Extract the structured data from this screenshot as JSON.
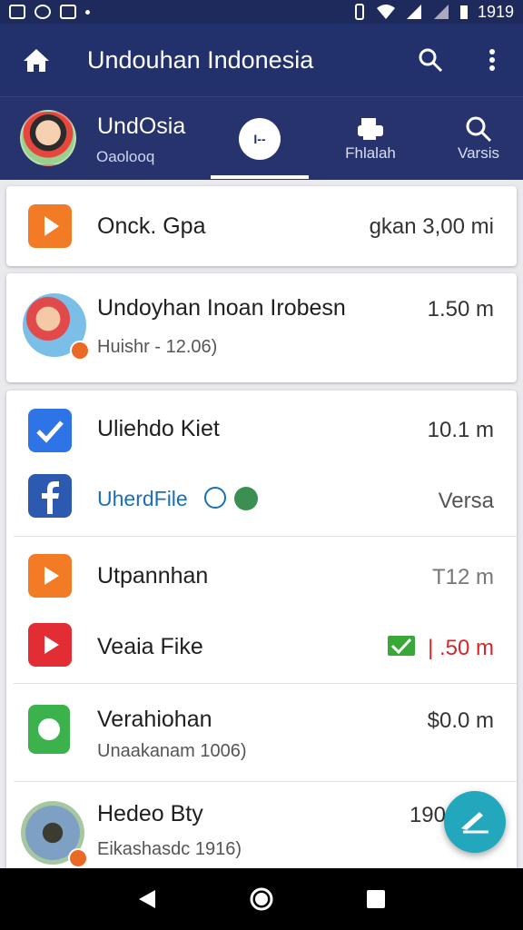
{
  "status_bar": {
    "time": "1919"
  },
  "app_bar": {
    "title": "Undouhan Indonesia"
  },
  "profile": {
    "name": "UndOsia",
    "subtitle": "Oaolooq"
  },
  "tabs": {
    "center_label": "I--",
    "flip_label": "Fhlalah",
    "versions_label": "Varsis"
  },
  "items": [
    {
      "title": "Onck. Gpa",
      "right": "gkan 3,00 mi"
    },
    {
      "title": "Undoyhan Inoan Irobesn",
      "subtitle": "Huishr - 12.06)",
      "right": "1.50 m"
    },
    {
      "title": "Uliehdo Kiet",
      "right": "10.1 m"
    },
    {
      "title": "UherdFile",
      "right": "Versa"
    },
    {
      "title": "Utpannhan",
      "right": "T12 m"
    },
    {
      "title": "Veaia Fike",
      "right": "| .50 m"
    },
    {
      "title": "Verahiohan",
      "subtitle": "Unaakanam 1006)",
      "right": "$0.0 m"
    },
    {
      "title": "Hedeo Bty",
      "subtitle": "Eikashasdc 1916)",
      "right": "190"
    }
  ],
  "colors": {
    "primary": "#22306b",
    "accent": "#23a7bd",
    "alert_red": "#d6262c",
    "ok_green": "#38a838"
  }
}
